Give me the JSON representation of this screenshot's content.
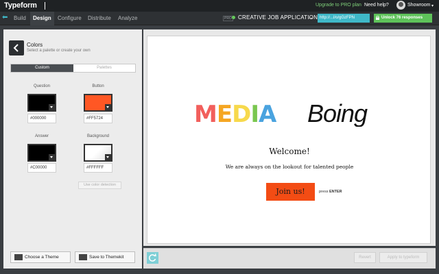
{
  "topbar": {
    "brand": "Typeform",
    "upgrade_label": "Upgrade to PRO plan",
    "help_label": "Need help?",
    "user_name": "Showroom",
    "user_caret": "▾"
  },
  "nav": {
    "back_arrow": "⬅",
    "tabs": [
      "Build",
      "Design",
      "Configure",
      "Distribute",
      "Analyze"
    ],
    "active_tab": "Design",
    "pro_badge": "PRO",
    "form_title": "CREATIVE JOB APPLICATION",
    "share_arrow": "→",
    "short_url": "http://...l/o/gGzFPN",
    "unlock_label": "Unlock 76 responses"
  },
  "colors_panel": {
    "title": "Colors",
    "subtitle": "Select a palette or create your own",
    "tabs": {
      "custom": "Custom",
      "palettes": "Palettes"
    },
    "question": {
      "label": "Question",
      "hex": "#000000",
      "color": "#000000"
    },
    "button": {
      "label": "Button",
      "hex": "#FF5724",
      "color": "#ff5724"
    },
    "answer": {
      "label": "Answer",
      "hex": "#C00000",
      "color": "#000000"
    },
    "background": {
      "label": "Background",
      "hex": "#FFFFFF",
      "color": "#ffffff"
    },
    "detect_label": "Use color detection",
    "choose_theme": "Choose a Theme",
    "save_themekit": "Save to Themekit"
  },
  "preview": {
    "logo_media": "MEDIA",
    "logo_boing": "Boing",
    "logo_colors": [
      "#f25f5c",
      "#f5a623",
      "#f7d94c",
      "#7ac74f",
      "#4aa3df",
      "#8e6cc9"
    ],
    "welcome": "Welcome!",
    "tagline": "We are always on the lookout for talented people",
    "join_label": "Join us!",
    "press_prefix": "press",
    "press_key": "ENTER"
  },
  "footer": {
    "revert_label": "Revert",
    "apply_label": "Apply to typeform"
  }
}
